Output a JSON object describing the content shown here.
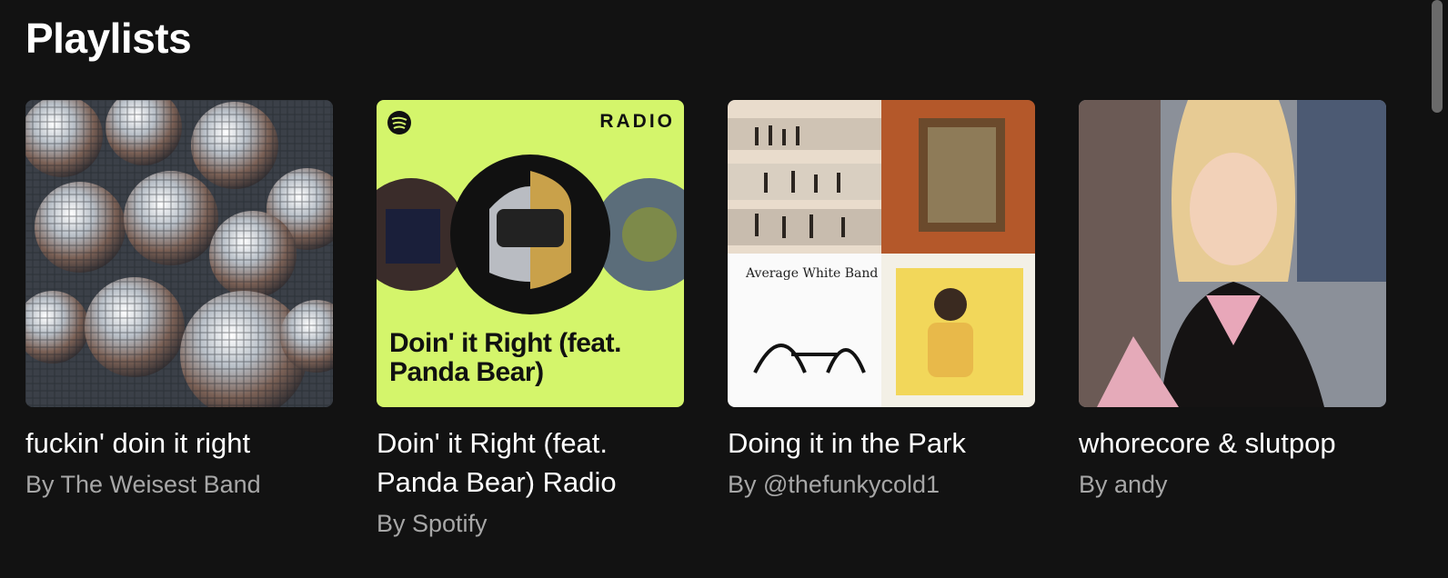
{
  "section": {
    "title": "Playlists"
  },
  "cards": [
    {
      "title": "fuckin' doin it right",
      "subtitle": "By The Weisest Band",
      "cover": "disco-balls-image"
    },
    {
      "title": "Doin' it Right (feat. Panda Bear) Radio",
      "subtitle": "By Spotify",
      "cover": "radio-cover",
      "cover_badge": "RADIO",
      "cover_text": "Doin' it Right (feat. Panda Bear)"
    },
    {
      "title": "Doing it in the Park",
      "subtitle": "By @thefunkycold1",
      "cover": "album-mosaic"
    },
    {
      "title": "whorecore & slutpop",
      "subtitle": "By andy",
      "cover": "movie-still-image"
    }
  ],
  "colors": {
    "background": "#121212",
    "radio_green": "#d4f56b",
    "subtitle": "#a7a7a7"
  }
}
